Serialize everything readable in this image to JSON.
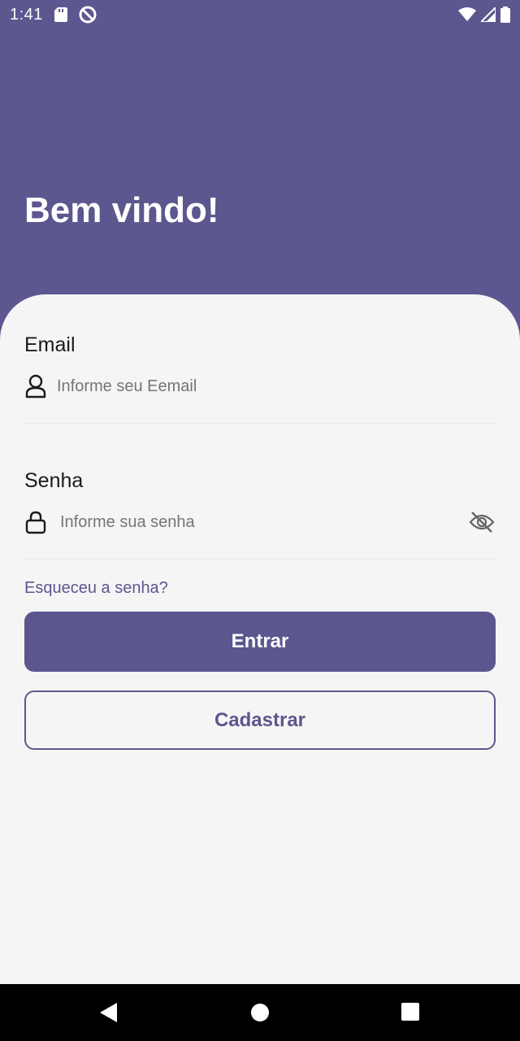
{
  "status_bar": {
    "time": "1:41",
    "icons_left": [
      "sd-card-icon",
      "do-not-disturb-icon"
    ],
    "icons_right": [
      "wifi-icon",
      "signal-icon",
      "battery-icon"
    ]
  },
  "header": {
    "title": "Bem vindo!"
  },
  "form": {
    "email": {
      "label": "Email",
      "placeholder": "Informe seu Eemail",
      "icon": "user-icon"
    },
    "password": {
      "label": "Senha",
      "placeholder": "Informe sua senha",
      "icon": "lock-icon",
      "toggle_icon": "eye-off-icon"
    },
    "forgot_password": "Esqueceu a senha?",
    "login_button": "Entrar",
    "register_button": "Cadastrar"
  },
  "nav_bar": {
    "buttons": [
      "back-icon",
      "home-icon",
      "recents-icon"
    ]
  },
  "colors": {
    "primary": "#5C578E",
    "background": "#F5F5F5",
    "text": "#1a1a1a"
  }
}
